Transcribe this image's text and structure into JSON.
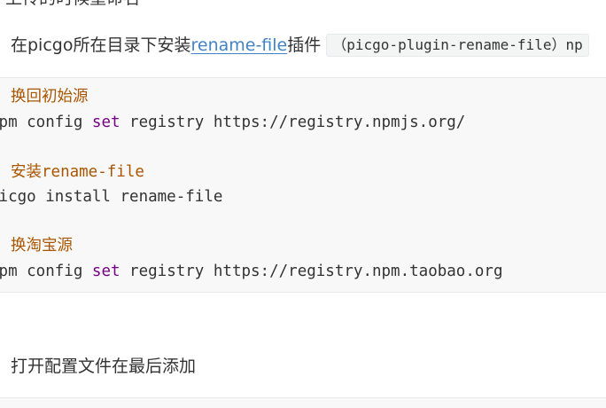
{
  "heading_partial": ". 上传的时候重命名",
  "install_paragraph": {
    "prefix": "在picgo所在目录下安装",
    "link_text": "rename-file",
    "middle": "插件",
    "inline_code": "（picgo-plugin-rename-file）np"
  },
  "code_block": {
    "comment_1": "换回初始源",
    "cmd_1": {
      "head": "npm config ",
      "keyword": "set",
      "tail": " registry https://registry.npmjs.org/"
    },
    "comment_2": "安装rename-file",
    "cmd_2": "picgo install rename-file",
    "comment_3": "换淘宝源",
    "cmd_3": {
      "head": "npm config ",
      "keyword": "set",
      "tail": " registry https://registry.npm.taobao.org"
    }
  },
  "config_paragraph": "打开配置文件在最后添加",
  "colors": {
    "link": "#4183c4",
    "comment": "#aa5500",
    "keyword": "#770088",
    "code_background": "#f8f8f8"
  }
}
